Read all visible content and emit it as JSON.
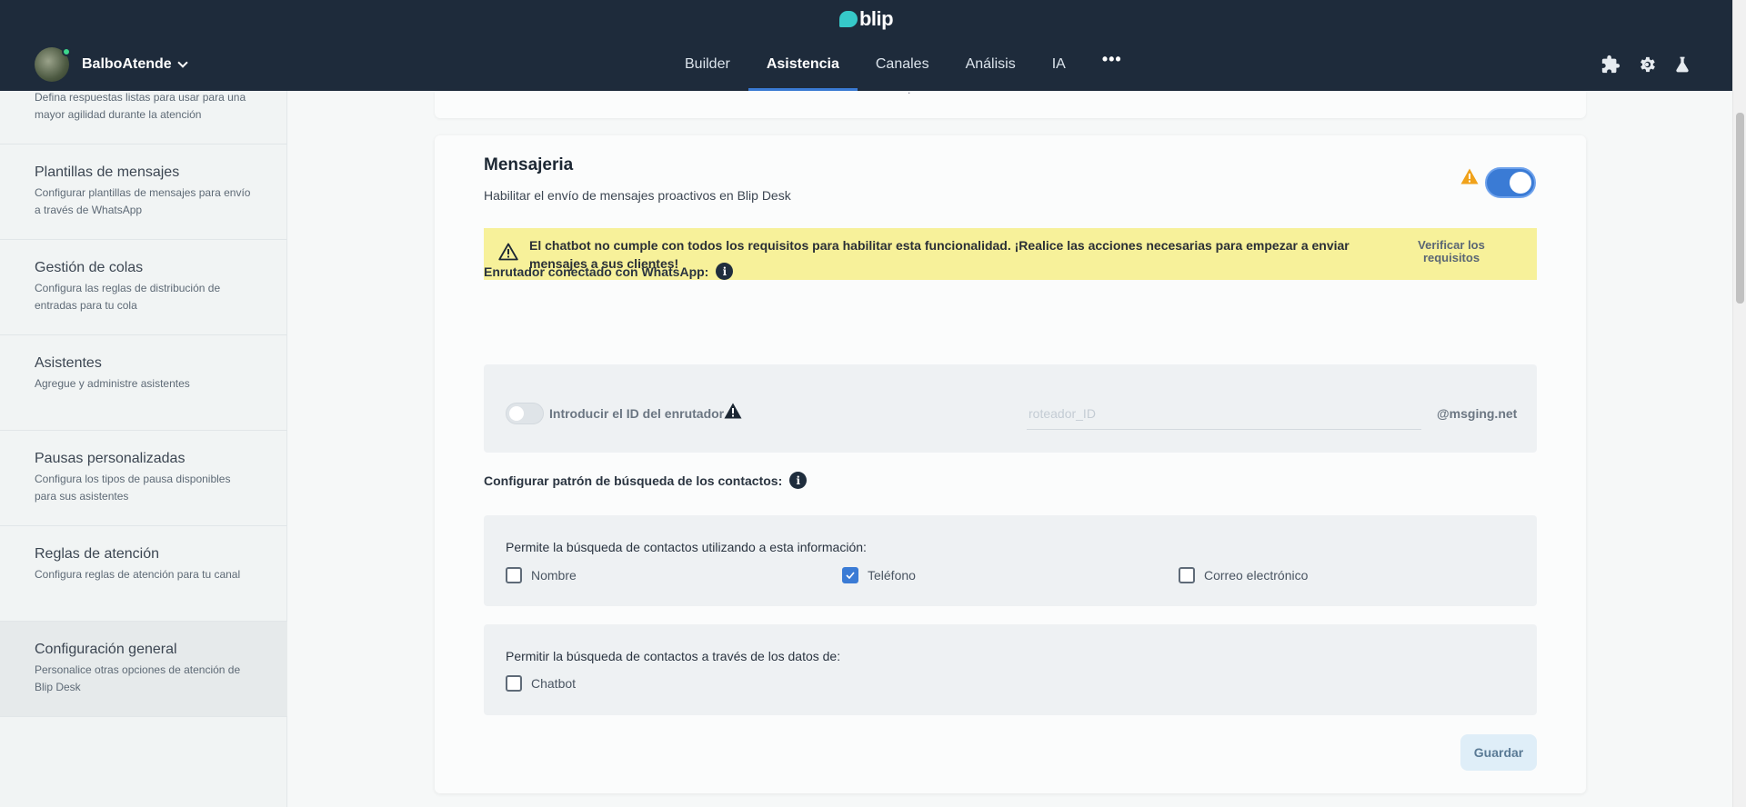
{
  "brand": {
    "name": "blip"
  },
  "user": {
    "name": "BalboAtende"
  },
  "nav": {
    "items": [
      {
        "label": "Builder"
      },
      {
        "label": "Asistencia"
      },
      {
        "label": "Canales"
      },
      {
        "label": "Análisis"
      },
      {
        "label": "IA"
      }
    ],
    "more": "•••",
    "active": "Asistencia"
  },
  "tools": [
    "puzzle-icon",
    "gear-icon",
    "flask-icon"
  ],
  "sidebar": {
    "partial_desc": "Defina respuestas listas para usar para una mayor agilidad durante la atención",
    "items": [
      {
        "title": "Plantillas de mensajes",
        "desc": "Configurar plantillas de mensajes para envío a través de WhatsApp"
      },
      {
        "title": "Gestión de colas",
        "desc": "Configura las reglas de distribución de entradas para tu cola"
      },
      {
        "title": "Asistentes",
        "desc": "Agregue y administre asistentes"
      },
      {
        "title": "Pausas personalizadas",
        "desc": "Configura los tipos de pausa disponibles para sus asistentes"
      },
      {
        "title": "Reglas de atención",
        "desc": "Configura reglas de atención para tu canal"
      },
      {
        "title": "Configuración general",
        "desc": "Personalice otras opciones de atención de Blip Desk"
      }
    ],
    "active": "Configuración general"
  },
  "card_top": {
    "fragment": "."
  },
  "main": {
    "title": "Mensajeria",
    "subtitle": "Habilitar el envío de mensajes proactivos en Blip Desk",
    "enabled": true,
    "alert": {
      "text": "El chatbot no cumple con todos los requisitos para habilitar esta funcionalidad. ¡Realice las acciones necesarias para empezar a enviar mensajes a sus clientes!",
      "link": "Verificar los requisitos"
    },
    "router": {
      "label": "Enrutador conectado con WhatsApp:",
      "toggle_label": "Introducir el ID del enrutador",
      "input_placeholder": "roteador_ID",
      "input_value": "",
      "suffix": "@msging.net",
      "enabled": false
    },
    "search_pattern": {
      "label": "Configurar patrón de búsqueda de los contactos:",
      "info_prompt": "Permite la búsqueda de contactos utilizando a esta información:",
      "options": [
        {
          "label": "Nombre",
          "checked": false
        },
        {
          "label": "Teléfono",
          "checked": true
        },
        {
          "label": "Correo electrónico",
          "checked": false
        }
      ],
      "data_prompt": "Permitir la búsqueda de contactos a través de los datos de:",
      "data_options": [
        {
          "label": "Chatbot",
          "checked": false
        }
      ]
    },
    "save_label": "Guardar"
  },
  "colors": {
    "topbar": "#1e2b3b",
    "accent": "#3a7bd5",
    "alert_bg": "#f7f19a",
    "warning": "#f0a21b"
  }
}
